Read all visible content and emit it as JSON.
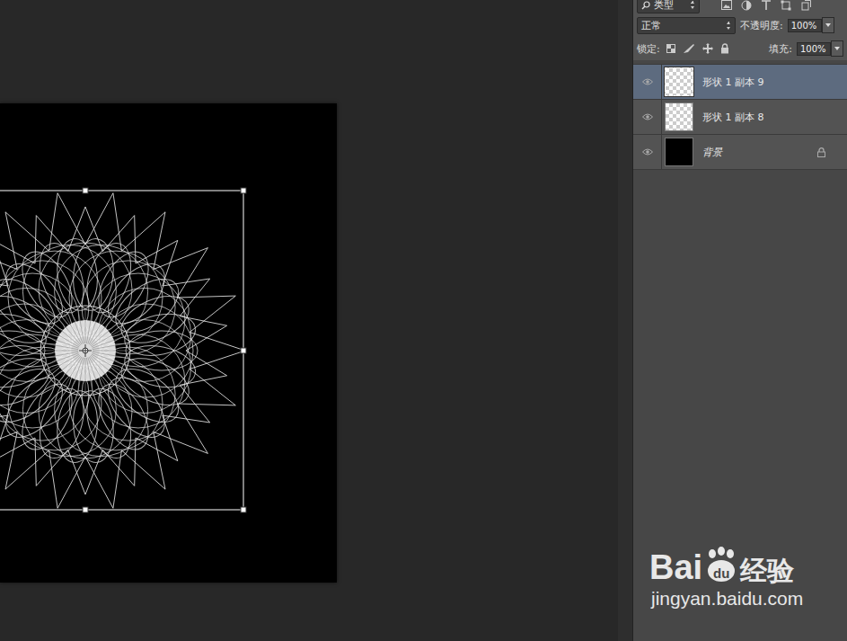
{
  "layers_panel": {
    "filter": {
      "kind": "类型"
    },
    "blend_mode": "正常",
    "opacity": {
      "label": "不透明度:",
      "value": "100%"
    },
    "lock": {
      "label": "锁定:"
    },
    "fill": {
      "label": "填充:",
      "value": "100%"
    },
    "layers": [
      {
        "name": "形状 1 副本 9",
        "visible": true,
        "selected": true,
        "locked": false,
        "kind": "shape"
      },
      {
        "name": "形状 1 副本 8",
        "visible": true,
        "selected": false,
        "locked": false,
        "kind": "shape"
      },
      {
        "name": "背景",
        "visible": true,
        "selected": false,
        "locked": true,
        "kind": "background"
      }
    ]
  },
  "watermark": {
    "brand": "Bai",
    "logo": "du",
    "brand2": "经验",
    "url": "jingyan.baidu.com"
  }
}
